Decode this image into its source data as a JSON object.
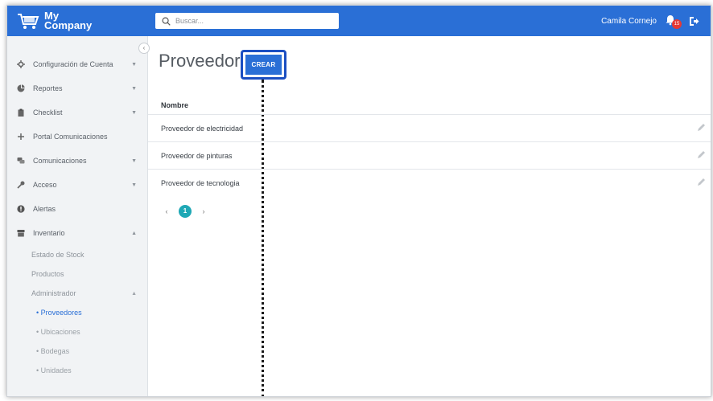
{
  "brand": {
    "line1": "My",
    "line2": "Company"
  },
  "search": {
    "placeholder": "Buscar..."
  },
  "user": {
    "name": "Camila Cornejo",
    "notifications": "15"
  },
  "sidebar": {
    "collapse_glyph": "‹",
    "items": [
      {
        "label": "Configuración de Cuenta",
        "icon": "gear-icon",
        "expandable": true
      },
      {
        "label": "Reportes",
        "icon": "pie-chart-icon",
        "expandable": true
      },
      {
        "label": "Checklist",
        "icon": "clipboard-icon",
        "expandable": true
      },
      {
        "label": "Portal Comunicaciones",
        "icon": "plus-icon",
        "expandable": false
      },
      {
        "label": "Comunicaciones",
        "icon": "chat-icon",
        "expandable": true
      },
      {
        "label": "Acceso",
        "icon": "key-icon",
        "expandable": true
      },
      {
        "label": "Alertas",
        "icon": "alert-icon",
        "expandable": false
      },
      {
        "label": "Inventario",
        "icon": "box-icon",
        "expandable": true,
        "expanded": true
      }
    ],
    "inventario_sub": [
      {
        "label": "Estado de Stock"
      },
      {
        "label": "Productos"
      },
      {
        "label": "Administrador",
        "expanded": true
      }
    ],
    "administrador_sub": [
      {
        "label": "• Proveedores",
        "active": true
      },
      {
        "label": "• Ubicaciones"
      },
      {
        "label": "• Bodegas"
      },
      {
        "label": "• Unidades"
      }
    ]
  },
  "main": {
    "title": "Proveedor",
    "create_label": "CREAR",
    "column_header": "Nombre",
    "rows": [
      {
        "name": "Proveedor de electricidad"
      },
      {
        "name": "Proveedor de pinturas"
      },
      {
        "name": "Proveedor de tecnologia"
      }
    ],
    "pagination": {
      "prev": "‹",
      "current": "1",
      "next": "›"
    }
  },
  "colors": {
    "topbar": "#2a6fd6",
    "accent": "#1b4fc2",
    "page_active": "#1fa8b5",
    "badge": "#e53935"
  }
}
